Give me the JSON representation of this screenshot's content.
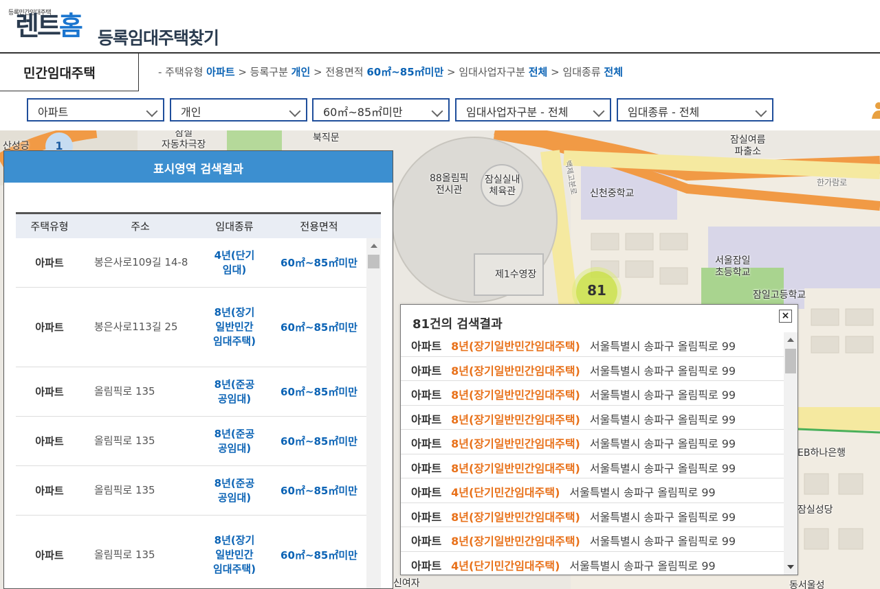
{
  "header": {
    "logo_small": "등록민간임대주택",
    "logo_rent": "렌트",
    "logo_home": "홈",
    "logo_sub": "등록임대주택찾기"
  },
  "nav": {
    "title": "민간임대주택",
    "crumb": [
      {
        "label": "- 주택유형 ",
        "value": "아파트"
      },
      {
        "label": " > 등록구분 ",
        "value": "개인"
      },
      {
        "label": " > 전용면적 ",
        "value": "60㎡~85㎡미만"
      },
      {
        "label": " > 임대사업자구분 ",
        "value": "전체"
      },
      {
        "label": " > 임대종류 ",
        "value": "전체"
      }
    ]
  },
  "filters": {
    "house_type": "아파트",
    "registration": "개인",
    "area": "60㎡~85㎡미만",
    "business_type": "임대사업자구분 - 전체",
    "rental_type": "임대종류 - 전체"
  },
  "map": {
    "labels": [
      {
        "text": "잠실\n자동차극장"
      },
      {
        "text": "북직문"
      },
      {
        "text": "88올림픽\n전시관"
      },
      {
        "text": "잠실실내\n체육관"
      },
      {
        "text": "신천중학교"
      },
      {
        "text": "잠실여름\n파출소"
      },
      {
        "text": "한가람로"
      },
      {
        "text": "서울잠일\n초등학교"
      },
      {
        "text": "잠일고등학교"
      },
      {
        "text": "제1수영장"
      },
      {
        "text": "EB하나은행"
      },
      {
        "text": "잠실성당"
      },
      {
        "text": "동서울성"
      },
      {
        "text": "산성긍"
      },
      {
        "text": "백제고분로"
      },
      {
        "text": "신여자"
      }
    ],
    "clusters": [
      {
        "count": "1"
      },
      {
        "count": "81"
      }
    ]
  },
  "panel": {
    "title": "표시영역 검색결과",
    "columns": [
      "주택유형",
      "주소",
      "임대종류",
      "전용면적"
    ],
    "rows": [
      {
        "type": "아파트",
        "address": "봉은사로109길 14-8",
        "rental": "4년(단기임대)",
        "area": "60㎡~85㎡미만"
      },
      {
        "type": "아파트",
        "address": "봉은사로113길 25",
        "rental": "8년(장기일반민간임대주택)",
        "area": "60㎡~85㎡미만"
      },
      {
        "type": "아파트",
        "address": "올림픽로 135",
        "rental": "8년(준공공임대)",
        "area": "60㎡~85㎡미만"
      },
      {
        "type": "아파트",
        "address": "올림픽로 135",
        "rental": "8년(준공공임대)",
        "area": "60㎡~85㎡미만"
      },
      {
        "type": "아파트",
        "address": "올림픽로 135",
        "rental": "8년(준공공임대)",
        "area": "60㎡~85㎡미만"
      },
      {
        "type": "아파트",
        "address": "올림픽로 135",
        "rental": "8년(장기일반민간임대주택)",
        "area": "60㎡~85㎡미만"
      }
    ]
  },
  "popup": {
    "title": "81건의 검색결과",
    "close": "×",
    "items": [
      {
        "type": "아파트",
        "kind": "8년(장기일반민간임대주택)",
        "address": "서울특별시 송파구 올림픽로 99"
      },
      {
        "type": "아파트",
        "kind": "8년(장기일반민간임대주택)",
        "address": "서울특별시 송파구 올림픽로 99"
      },
      {
        "type": "아파트",
        "kind": "8년(장기일반민간임대주택)",
        "address": "서울특별시 송파구 올림픽로 99"
      },
      {
        "type": "아파트",
        "kind": "8년(장기일반민간임대주택)",
        "address": "서울특별시 송파구 올림픽로 99"
      },
      {
        "type": "아파트",
        "kind": "8년(장기일반민간임대주택)",
        "address": "서울특별시 송파구 올림픽로 99"
      },
      {
        "type": "아파트",
        "kind": "8년(장기일반민간임대주택)",
        "address": "서울특별시 송파구 올림픽로 99"
      },
      {
        "type": "아파트",
        "kind": "4년(단기민간임대주택)",
        "address": "서울특별시 송파구 올림픽로 99"
      },
      {
        "type": "아파트",
        "kind": "8년(장기일반민간임대주택)",
        "address": "서울특별시 송파구 올림픽로 99"
      },
      {
        "type": "아파트",
        "kind": "8년(장기일반민간임대주택)",
        "address": "서울특별시 송파구 올림픽로 99"
      },
      {
        "type": "아파트",
        "kind": "4년(단기민간임대주택)",
        "address": "서울특별시 송파구 올림픽로 99"
      }
    ]
  }
}
